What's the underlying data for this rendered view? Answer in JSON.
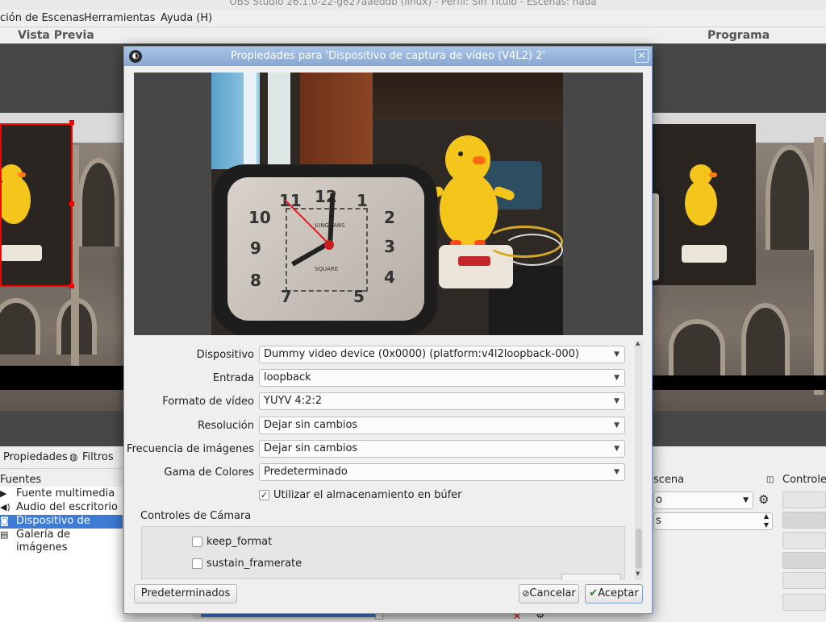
{
  "window": {
    "title": "OBS Studio 26.1.0-22-g627aaeddb (linux) - Perfil: Sin Título - Escenas: nada"
  },
  "menu": {
    "items": [
      "ción de Escenas",
      "Herramientas",
      "Ayuda (H)"
    ]
  },
  "panels": {
    "preview_label": "Vista Previa",
    "program_label": "Programa"
  },
  "docks": {
    "props_tab": "Propiedades",
    "filters_tab": "Filtros",
    "sources_header": "Fuentes",
    "sources": [
      {
        "label": "Fuente multimedia",
        "icon": "play-icon",
        "selected": false
      },
      {
        "label": "Audio del escritorio",
        "icon": "speaker-icon",
        "selected": false
      },
      {
        "label": "Dispositivo de captura",
        "icon": "camera-icon",
        "selected": true
      },
      {
        "label": "Galería de imágenes",
        "icon": "images-icon",
        "selected": false
      }
    ],
    "scene_header": "scena",
    "scene_combo": "o",
    "scene_spin": "s",
    "controls_header": "Controles"
  },
  "dialog": {
    "title": "Propiedades para 'Dispositivo de captura de vídeo (V4L2) 2'",
    "clock": {
      "brand": "JUNGHANS",
      "brand2": "SQUARE",
      "numbers": [
        "11",
        "12",
        "1",
        "2",
        "3",
        "4",
        "5",
        "7",
        "8",
        "9",
        "10"
      ]
    },
    "properties": [
      {
        "label": "Dispositivo",
        "value": "Dummy video device (0x0000) (platform:v4l2loopback-000)"
      },
      {
        "label": "Entrada",
        "value": "loopback"
      },
      {
        "label": "Formato de vídeo",
        "value": "YUYV 4:2:2"
      },
      {
        "label": "Resolución",
        "value": "Dejar sin cambios"
      },
      {
        "label": "Frecuencia de imágenes",
        "value": "Dejar sin cambios"
      },
      {
        "label": "Gama de Colores",
        "value": "Predeterminado"
      }
    ],
    "buffer_checkbox": {
      "label": "Utilizar el almacenamiento en búfer",
      "checked": true
    },
    "camera_controls_header": "Controles de Cámara",
    "camera_controls": [
      {
        "label": "keep_format",
        "checked": false
      },
      {
        "label": "sustain_framerate",
        "checked": false
      }
    ],
    "defaults_button": "Predeterminados",
    "cancel_button": "Cancelar",
    "accept_button": "Aceptar"
  },
  "colors": {
    "title_bar": "#98b6dc",
    "selection": "#3d7bd4",
    "selection_box": "#ff0000"
  }
}
